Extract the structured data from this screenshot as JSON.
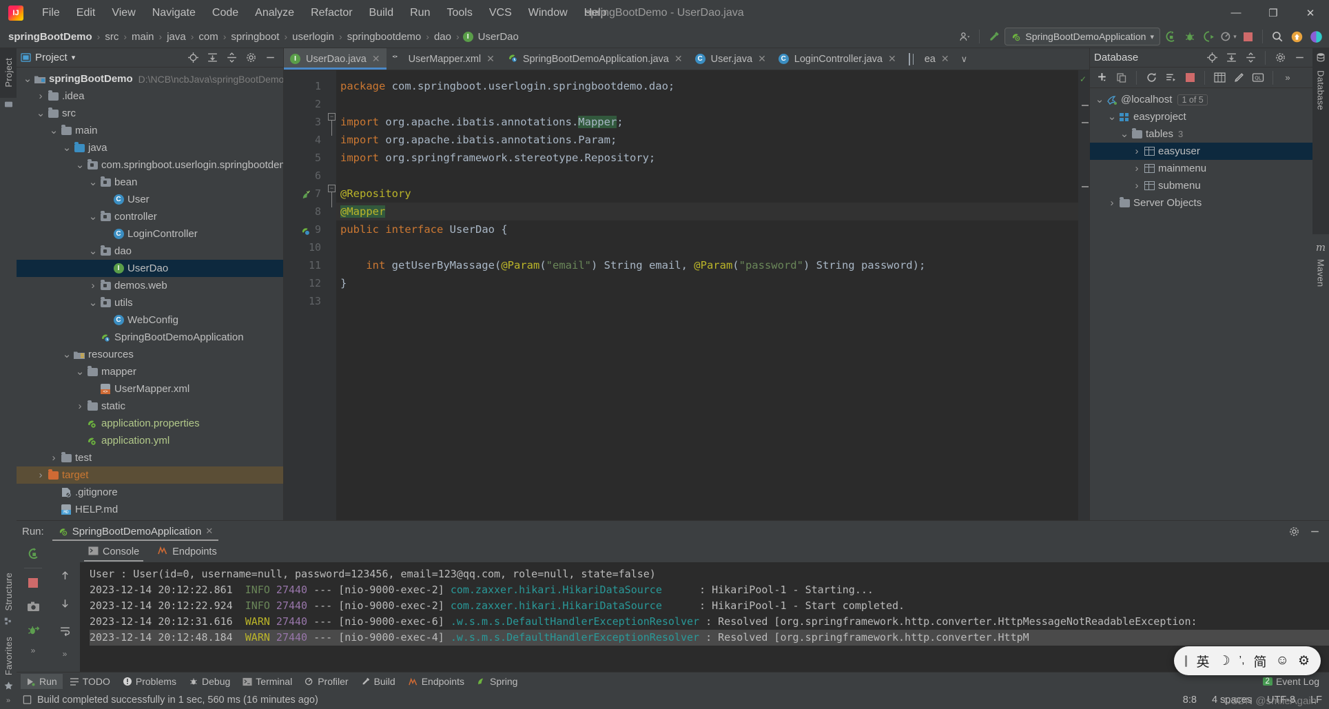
{
  "titlebar": {
    "logo": "IJ",
    "menus": [
      "File",
      "Edit",
      "View",
      "Navigate",
      "Code",
      "Analyze",
      "Refactor",
      "Build",
      "Run",
      "Tools",
      "VCS",
      "Window",
      "Help"
    ],
    "window_title": "springBootDemo - UserDao.java",
    "minimize": "—",
    "maximize": "❐",
    "close": "✕"
  },
  "navbar": {
    "crumbs": [
      {
        "label": "springBootDemo",
        "bold": true
      },
      {
        "label": "src",
        "bold": false
      },
      {
        "label": "main",
        "bold": false
      },
      {
        "label": "java",
        "bold": false
      },
      {
        "label": "com",
        "bold": false
      },
      {
        "label": "springboot",
        "bold": false
      },
      {
        "label": "userlogin",
        "bold": false
      },
      {
        "label": "springbootdemo",
        "bold": false
      },
      {
        "label": "dao",
        "bold": false
      },
      {
        "label": "UserDao",
        "bold": false,
        "icon": "interface-icon"
      }
    ],
    "separator": "›",
    "run_config": "SpringBootDemoApplication",
    "run_config_caret": "▾"
  },
  "project_panel": {
    "title": "Project",
    "caret": "▾",
    "strip_label": "Project",
    "tree": [
      {
        "depth": 0,
        "arrow": "v",
        "icon": "project-folder-icon",
        "label": "springBootDemo",
        "bold": true,
        "sub": "D:\\NCB\\ncbJava\\springBootDemo"
      },
      {
        "depth": 1,
        "arrow": ">",
        "icon": "folder-icon",
        "label": ".idea"
      },
      {
        "depth": 1,
        "arrow": "v",
        "icon": "folder-icon",
        "label": "src"
      },
      {
        "depth": 2,
        "arrow": "v",
        "icon": "folder-icon",
        "label": "main"
      },
      {
        "depth": 3,
        "arrow": "v",
        "icon": "source-folder-icon",
        "label": "java"
      },
      {
        "depth": 4,
        "arrow": "v",
        "icon": "package-icon",
        "label": "com.springboot.userlogin.springbootdemo"
      },
      {
        "depth": 5,
        "arrow": "v",
        "icon": "package-icon",
        "label": "bean"
      },
      {
        "depth": 6,
        "arrow": "",
        "icon": "class-icon",
        "label": "User"
      },
      {
        "depth": 5,
        "arrow": "v",
        "icon": "package-icon",
        "label": "controller"
      },
      {
        "depth": 6,
        "arrow": "",
        "icon": "class-icon",
        "label": "LoginController"
      },
      {
        "depth": 5,
        "arrow": "v",
        "icon": "package-icon",
        "label": "dao"
      },
      {
        "depth": 6,
        "arrow": "",
        "icon": "interface-icon",
        "label": "UserDao",
        "selected": true
      },
      {
        "depth": 5,
        "arrow": ">",
        "icon": "package-icon",
        "label": "demos.web"
      },
      {
        "depth": 5,
        "arrow": "v",
        "icon": "package-icon",
        "label": "utils"
      },
      {
        "depth": 6,
        "arrow": "",
        "icon": "class-icon",
        "label": "WebConfig"
      },
      {
        "depth": 5,
        "arrow": "",
        "icon": "spring-boot-icon",
        "label": "SpringBootDemoApplication"
      },
      {
        "depth": 3,
        "arrow": "v",
        "icon": "resources-folder-icon",
        "label": "resources"
      },
      {
        "depth": 4,
        "arrow": "v",
        "icon": "folder-icon",
        "label": "mapper"
      },
      {
        "depth": 5,
        "arrow": "",
        "icon": "xml-file-icon",
        "label": "UserMapper.xml"
      },
      {
        "depth": 4,
        "arrow": ">",
        "icon": "folder-icon",
        "label": "static"
      },
      {
        "depth": 4,
        "arrow": "",
        "icon": "spring-config-icon",
        "label": "application.properties"
      },
      {
        "depth": 4,
        "arrow": "",
        "icon": "spring-config-icon",
        "label": "application.yml"
      },
      {
        "depth": 2,
        "arrow": ">",
        "icon": "folder-icon",
        "label": "test"
      },
      {
        "depth": 1,
        "arrow": ">",
        "icon": "target-folder-icon",
        "label": "target",
        "selected_orange": true
      },
      {
        "depth": 2,
        "arrow": "",
        "icon": "gitignore-icon",
        "label": ".gitignore"
      },
      {
        "depth": 2,
        "arrow": "",
        "icon": "markdown-icon",
        "label": "HELP.md"
      }
    ]
  },
  "editor": {
    "tabs": [
      {
        "label": "UserDao.java",
        "icon": "interface-icon",
        "active": true
      },
      {
        "label": "UserMapper.xml",
        "icon": "xml-file-icon",
        "active": false
      },
      {
        "label": "SpringBootDemoApplication.java",
        "icon": "spring-boot-icon",
        "active": false
      },
      {
        "label": "User.java",
        "icon": "class-icon",
        "active": false
      },
      {
        "label": "LoginController.java",
        "icon": "class-icon",
        "active": false
      },
      {
        "label": "ea",
        "icon": "table-icon",
        "active": false
      }
    ],
    "tab_close": "✕",
    "tab_overflow_caret": "∨",
    "lines": [
      {
        "n": 1,
        "tokens": [
          {
            "t": "package",
            "c": "kw"
          },
          {
            "t": " com.springboot.userlogin.springbootdemo.dao;",
            "c": "ident"
          }
        ]
      },
      {
        "n": 2,
        "tokens": []
      },
      {
        "n": 3,
        "tokens": [
          {
            "t": "import",
            "c": "kw"
          },
          {
            "t": " org.apache.ibatis.annotations.",
            "c": "ident"
          },
          {
            "t": "Mapper",
            "c": "hl"
          },
          {
            "t": ";",
            "c": "ident"
          }
        ]
      },
      {
        "n": 4,
        "tokens": [
          {
            "t": "import",
            "c": "kw"
          },
          {
            "t": " org.apache.ibatis.annotations.Param;",
            "c": "ident"
          }
        ]
      },
      {
        "n": 5,
        "tokens": [
          {
            "t": "import",
            "c": "kw"
          },
          {
            "t": " org.springframework.stereotype.Repository;",
            "c": "ident"
          }
        ]
      },
      {
        "n": 6,
        "tokens": []
      },
      {
        "n": 7,
        "tokens": [
          {
            "t": "@Repository",
            "c": "ann"
          }
        ]
      },
      {
        "n": 8,
        "tokens": [
          {
            "t": "@Mapper",
            "c": "ann hl"
          }
        ],
        "current": true
      },
      {
        "n": 9,
        "tokens": [
          {
            "t": "public",
            "c": "kw"
          },
          {
            "t": " ",
            "c": "ident"
          },
          {
            "t": "interface",
            "c": "kw"
          },
          {
            "t": " UserDao {",
            "c": "ident"
          }
        ]
      },
      {
        "n": 10,
        "tokens": []
      },
      {
        "n": 11,
        "tokens": [
          {
            "t": "    ",
            "c": "ident"
          },
          {
            "t": "int",
            "c": "kw"
          },
          {
            "t": " getUserByMassage(",
            "c": "ident"
          },
          {
            "t": "@Param",
            "c": "ann"
          },
          {
            "t": "(",
            "c": "ident"
          },
          {
            "t": "\"email\"",
            "c": "str"
          },
          {
            "t": ") String email, ",
            "c": "ident"
          },
          {
            "t": "@Param",
            "c": "ann"
          },
          {
            "t": "(",
            "c": "ident"
          },
          {
            "t": "\"password\"",
            "c": "str"
          },
          {
            "t": ") String password);",
            "c": "ident"
          }
        ]
      },
      {
        "n": 12,
        "tokens": [
          {
            "t": "}",
            "c": "ident"
          }
        ]
      },
      {
        "n": 13,
        "tokens": []
      }
    ]
  },
  "database_panel": {
    "title": "Database",
    "strip_label_db": "Database",
    "strip_label_maven": "Maven",
    "overflow": "»",
    "tree": [
      {
        "depth": 0,
        "arrow": "v",
        "icon": "mysql-icon",
        "label": "@localhost",
        "badge": "1 of 5"
      },
      {
        "depth": 1,
        "arrow": "v",
        "icon": "schema-icon",
        "label": "easyproject"
      },
      {
        "depth": 2,
        "arrow": "v",
        "icon": "folder-icon",
        "label": "tables",
        "count": "3"
      },
      {
        "depth": 3,
        "arrow": ">",
        "icon": "table-icon",
        "label": "easyuser",
        "selected": true
      },
      {
        "depth": 3,
        "arrow": ">",
        "icon": "table-icon",
        "label": "mainmenu"
      },
      {
        "depth": 3,
        "arrow": ">",
        "icon": "table-icon",
        "label": "submenu"
      },
      {
        "depth": 1,
        "arrow": ">",
        "icon": "folder-icon",
        "label": "Server Objects"
      }
    ]
  },
  "run_panel": {
    "label": "Run:",
    "tab": "SpringBootDemoApplication",
    "tab_close": "✕",
    "console_tabs": [
      {
        "label": "Console",
        "icon": "console-icon",
        "active": true
      },
      {
        "label": "Endpoints",
        "icon": "endpoints-icon",
        "active": false
      }
    ],
    "lines": [
      {
        "segments": [
          {
            "t": "User : User(id=0, username=null, password=123456, email=123@qq.com, role=null, state=false)",
            "c": "c-plain"
          }
        ]
      },
      {
        "segments": [
          {
            "t": "2023-12-14 20:12:22.861 ",
            "c": "c-plain"
          },
          {
            "t": " INFO",
            "c": "c-info"
          },
          {
            "t": " 27440",
            "c": "c-pid"
          },
          {
            "t": " --- [nio-9000-exec-2] ",
            "c": "c-plain"
          },
          {
            "t": "com.zaxxer.hikari.HikariDataSource",
            "c": "c-logger"
          },
          {
            "t": "      : HikariPool-1 - Starting...",
            "c": "c-plain"
          }
        ]
      },
      {
        "segments": [
          {
            "t": "2023-12-14 20:12:22.924 ",
            "c": "c-plain"
          },
          {
            "t": " INFO",
            "c": "c-info"
          },
          {
            "t": " 27440",
            "c": "c-pid"
          },
          {
            "t": " --- [nio-9000-exec-2] ",
            "c": "c-plain"
          },
          {
            "t": "com.zaxxer.hikari.HikariDataSource",
            "c": "c-logger"
          },
          {
            "t": "      : HikariPool-1 - Start completed.",
            "c": "c-plain"
          }
        ]
      },
      {
        "segments": [
          {
            "t": "2023-12-14 20:12:31.616 ",
            "c": "c-plain"
          },
          {
            "t": " WARN",
            "c": "c-warn"
          },
          {
            "t": " 27440",
            "c": "c-pid"
          },
          {
            "t": " --- [nio-9000-exec-6] ",
            "c": "c-plain"
          },
          {
            "t": ".w.s.m.s.DefaultHandlerExceptionResolver",
            "c": "c-logger"
          },
          {
            "t": " : Resolved [org.springframework.http.converter.HttpMessageNotReadableException:",
            "c": "c-plain"
          }
        ]
      },
      {
        "segments": [
          {
            "t": "2023-12-14 20:12:48.184 ",
            "c": "c-plain"
          },
          {
            "t": " WARN",
            "c": "c-warn"
          },
          {
            "t": " 27440",
            "c": "c-pid"
          },
          {
            "t": " --- [nio-9000-exec-4] ",
            "c": "c-plain"
          },
          {
            "t": ".w.s.m.s.DefaultHandlerExceptionResolver",
            "c": "c-logger"
          },
          {
            "t": " : Resolved [org.springframework.http.converter.HttpM",
            "c": "c-plain"
          }
        ],
        "selected": true
      }
    ]
  },
  "toolwindow_bar": {
    "items": [
      {
        "label": "Run",
        "icon": "run-icon",
        "active": true
      },
      {
        "label": "TODO",
        "icon": "todo-icon",
        "active": false
      },
      {
        "label": "Problems",
        "icon": "problems-icon",
        "active": false
      },
      {
        "label": "Debug",
        "icon": "debug-icon",
        "active": false
      },
      {
        "label": "Terminal",
        "icon": "terminal-icon",
        "active": false
      },
      {
        "label": "Profiler",
        "icon": "profiler-icon",
        "active": false
      },
      {
        "label": "Build",
        "icon": "build-icon",
        "active": false
      },
      {
        "label": "Endpoints",
        "icon": "endpoints-icon",
        "active": false
      },
      {
        "label": "Spring",
        "icon": "spring-icon",
        "active": false
      }
    ],
    "event_log": "Event Log",
    "event_log_count": "2"
  },
  "statusbar": {
    "message": "Build completed successfully in 1 sec, 560 ms (16 minutes ago)",
    "caret_position": "8:8",
    "indent": "4 spaces",
    "encoding": "UTF-8",
    "line_sep": "LF",
    "watermark": "CSDN @smileAgain"
  },
  "ime": {
    "mode": "英",
    "moon": "☽",
    "punct": "’,",
    "script": "简",
    "emoji": "☺",
    "settings": "⚙"
  },
  "left_strips": {
    "structure": "Structure",
    "favorites": "Favorites"
  },
  "colors": {
    "accent": "#4a88c7",
    "selection": "#0d293e",
    "selection_orange": "#5b4e36",
    "editor_bg": "#2b2b2b",
    "panel_bg": "#3c3f41",
    "warn": "#bbb529",
    "info": "#6a8759"
  }
}
